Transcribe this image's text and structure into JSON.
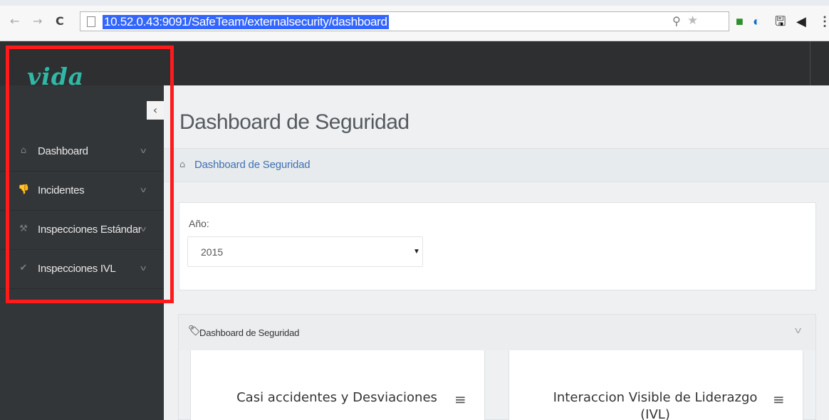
{
  "browser": {
    "url": "10.52.0.43:9091/SafeTeam/externalsecurity/dashboard",
    "nav": {
      "back": "←",
      "forward": "→",
      "reload": "C"
    },
    "omnibox_icons": {
      "search": "⚲",
      "star": "★"
    },
    "extensions": {
      "ext1": "■",
      "ext2": "◐",
      "ext3": "🖫",
      "ext4": "◀",
      "menu": "⋮"
    }
  },
  "app": {
    "logo": "vida",
    "colors": {
      "topbar": "#2d2f31",
      "sidebar": "#333638",
      "logo": "#2fb8a6",
      "link": "#3f71b1",
      "highlight_frame": "#ff1b1b"
    }
  },
  "sidebar": {
    "toggle": "‹",
    "items": [
      {
        "label": "Dashboard",
        "icon": "⌂",
        "icon_name": "home-icon",
        "chevron": "v"
      },
      {
        "label": "Incidentes",
        "icon": "👎",
        "icon_name": "thumbs-down-icon",
        "chevron": "v"
      },
      {
        "label": "Inspecciones Estándar",
        "icon": "⚒",
        "icon_name": "gavel-icon",
        "chevron": "v"
      },
      {
        "label": "Inspecciones IVL",
        "icon": "✔",
        "icon_name": "check-icon",
        "chevron": "v"
      }
    ]
  },
  "main": {
    "title": "Dashboard de Seguridad",
    "breadcrumb": {
      "icon": "⌂",
      "text": "Dashboard de Seguridad"
    },
    "filter": {
      "label": "Año:",
      "selected": "2015",
      "arrow": "▼"
    },
    "panel": {
      "icon": "🏷",
      "title": "Dashboard de Seguridad",
      "collapse": "v",
      "charts": [
        {
          "title": "Casi accidentes y Desviaciones",
          "menu": "≡"
        },
        {
          "title": "Interaccion Visible de Liderazgo (IVL)",
          "menu": "≡"
        }
      ]
    }
  }
}
